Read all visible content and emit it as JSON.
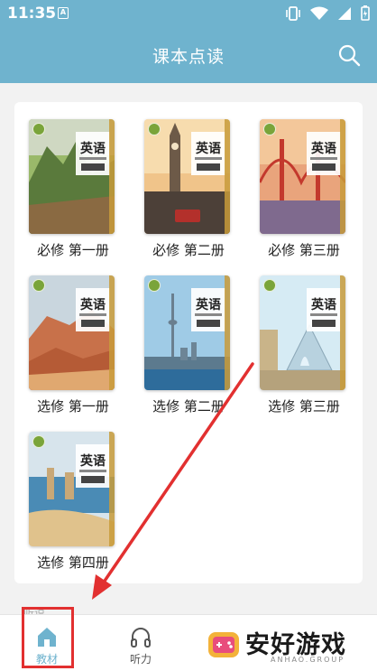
{
  "status_bar": {
    "time": "11:35",
    "sim_badge": "A"
  },
  "app_bar": {
    "title": "课本点读",
    "search_icon": "search-icon"
  },
  "books": [
    {
      "label": "必修 第一册",
      "cover_title": "英语",
      "theme": [
        "#6a8f54",
        "#c4a66b"
      ]
    },
    {
      "label": "必修 第二册",
      "cover_title": "英语",
      "theme": [
        "#e9b77a",
        "#6b5a4a"
      ]
    },
    {
      "label": "必修 第三册",
      "cover_title": "英语",
      "theme": [
        "#f0c08a",
        "#c23a2f"
      ]
    },
    {
      "label": "选修 第一册",
      "cover_title": "英语",
      "theme": [
        "#b7c9d8",
        "#c56b3a"
      ]
    },
    {
      "label": "选修 第二册",
      "cover_title": "英语",
      "theme": [
        "#8fc3e3",
        "#2a6a9e"
      ]
    },
    {
      "label": "选修 第三册",
      "cover_title": "英语",
      "theme": [
        "#cfe6f2",
        "#c9b489"
      ]
    },
    {
      "label": "选修 第四册",
      "cover_title": "英语",
      "theme": [
        "#d9c6a6",
        "#4a8bb5"
      ]
    }
  ],
  "footer_hint": "听说",
  "tabs": [
    {
      "label": "教材",
      "icon": "home-icon",
      "active": true
    },
    {
      "label": "听力",
      "icon": "headphones-icon",
      "active": false
    }
  ],
  "watermark": {
    "text": "安好游戏",
    "sub": "ANHAO.GROUP"
  },
  "colors": {
    "primary": "#6fb3ce",
    "annotation": "#e23030"
  }
}
